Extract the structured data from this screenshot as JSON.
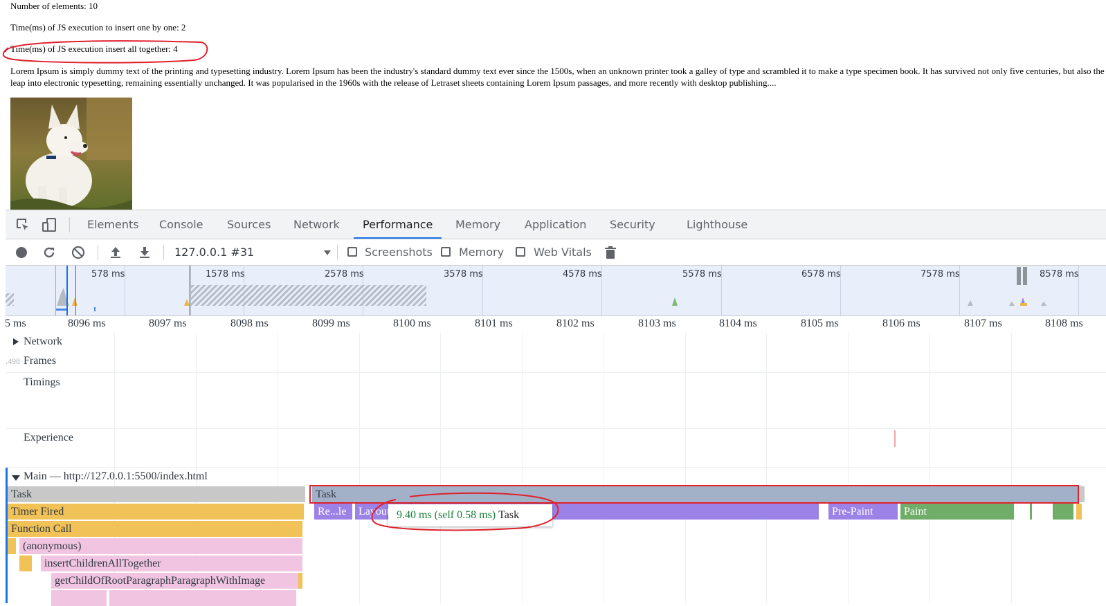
{
  "page": {
    "count_line": "Number of elements: 10",
    "one_by_one_line": "Time(ms) of JS execution to insert one by one: 2",
    "all_together_line": "Time(ms) of JS execution insert all together: 4",
    "lorem": "Lorem Ipsum is simply dummy text of the printing and typesetting industry. Lorem Ipsum has been the industry's standard dummy text ever since the 1500s, when an unknown printer took a galley of type and scrambled it to make a type specimen book. It has survived not only five centuries, but also the leap into electronic typesetting, remaining essentially unchanged. It was popularised in the 1960s with the release of Letraset sheets containing Lorem Ipsum passages, and more recently with desktop publishing...."
  },
  "devtools": {
    "tabs": [
      "Elements",
      "Console",
      "Sources",
      "Network",
      "Performance",
      "Memory",
      "Application",
      "Security",
      "Lighthouse"
    ],
    "active_tab": "Performance",
    "toolbar": {
      "profile_select": "127.0.0.1 #31",
      "screenshots_label": "Screenshots",
      "memory_label": "Memory",
      "web_vitals_label": "Web Vitals"
    },
    "overview_ticks": [
      "578 ms",
      "1578 ms",
      "2578 ms",
      "3578 ms",
      "4578 ms",
      "5578 ms",
      "6578 ms",
      "7578 ms",
      "8578 ms"
    ],
    "ruler_ticks": [
      "5 ms",
      "8096 ms",
      "8097 ms",
      "8098 ms",
      "8099 ms",
      "8100 ms",
      "8101 ms",
      "8102 ms",
      "8103 ms",
      "8104 ms",
      "8105 ms",
      "8106 ms",
      "8107 ms",
      "8108 ms"
    ],
    "tracks": {
      "network": "Network",
      "frames_count": ".498",
      "frames": "Frames",
      "timings": "Timings",
      "experience": "Experience",
      "main": "Main — http://127.0.0.1:5500/index.html"
    },
    "flame": {
      "task_left": "Task",
      "task_right": "Task",
      "timer_fired": "Timer Fired",
      "function_call": "Function Call",
      "anonymous": "(anonymous)",
      "insert_all": "insertChildrenAllTogether",
      "get_child": "getChildOfRootParagraphParagraphWithImage",
      "recalc": "Re...le",
      "layout": "Layout",
      "pre_paint": "Pre-Paint",
      "paint": "Paint"
    },
    "tooltip": {
      "time": "9.40 ms (self 0.58 ms)",
      "name": "Task"
    },
    "colors": {
      "task_gray": "#c8c8c8",
      "task_blue": "#a3b1c8",
      "scripting_yellow": "#f0c257",
      "js_pink": "#f1c5e1",
      "rendering_purple": "#9b82e6",
      "painting_green": "#70ad69",
      "annotation_red": "#e0202b",
      "active_tab_blue": "#1a73e8"
    }
  }
}
